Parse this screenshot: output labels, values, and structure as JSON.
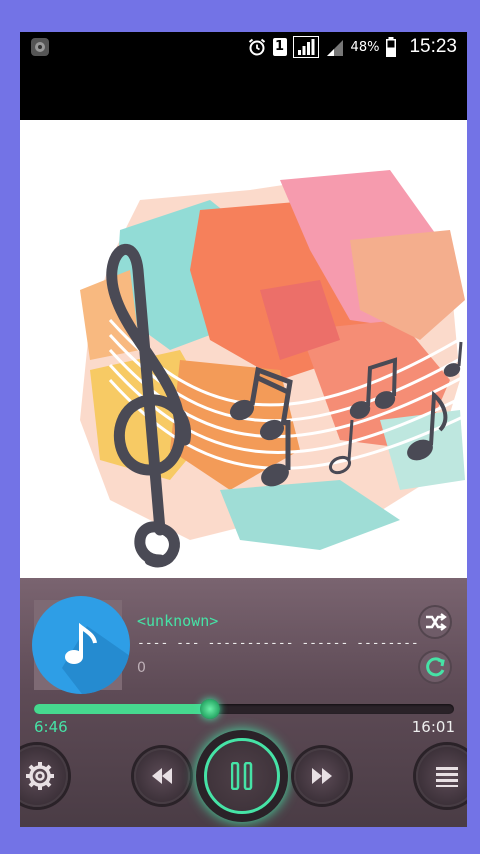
{
  "status_bar": {
    "battery_percent": "48%",
    "time": "15:23",
    "sim_label": "1",
    "icons": [
      "app-icon",
      "alarm-icon",
      "sim-icon",
      "signal-icon",
      "signal2-icon",
      "battery-icon"
    ]
  },
  "album_art": {
    "description_icon": "music-notes-artwork"
  },
  "player": {
    "title": "<unknown>",
    "subtitle": "---- --- ----------- ------ -------- -- -...",
    "track_number": "0",
    "current_time": "6:46",
    "total_time": "16:01",
    "progress": 0.42,
    "accent_color": "#46e3a6",
    "thumb_color": "#2e9ee6",
    "buttons": {
      "shuffle": "shuffle-icon",
      "repeat": "repeat-icon",
      "settings": "gear-icon",
      "previous": "rewind-icon",
      "play_pause": "pause-icon",
      "next": "fast-forward-icon",
      "menu": "menu-icon"
    }
  }
}
